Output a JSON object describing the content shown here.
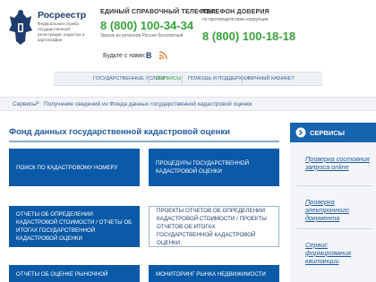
{
  "header": {
    "brand_name": "Росреестр",
    "brand_subtitle": "Федеральная служба государственной регистрации, кадастра и картографии",
    "hotline_title": "ЕДИНЫЙ СПРАВОЧНЫЙ ТЕЛЕФОН:",
    "hotline_phone": "8 (800) 100-34-34",
    "hotline_note": "Звонок из регионов России бесплатный",
    "trust_title": "ТЕЛЕФОН ДОВЕРИЯ",
    "trust_note": "по противодействию коррупции",
    "trust_phone": "8 (800) 100-18-18",
    "social_label": "Будьте с нами:",
    "social_vk": "B"
  },
  "nav": {
    "items": [
      {
        "label": "ГОСУДАРСТВЕННЫЕ УСЛУГИ",
        "active": false
      },
      {
        "label": "СЕРВИСЫ",
        "active": true
      },
      {
        "label": "ПОМОЩЬ И ПОДДЕРЖКА",
        "active": false
      },
      {
        "label": "ЛИЧНЫЙ КАБИНЕТ",
        "active": false
      }
    ]
  },
  "breadcrumb": {
    "items": [
      "Сервисы",
      "Получение сведений из Фонда данных государственной кадастровой оценки"
    ],
    "separator": ">"
  },
  "main": {
    "title": "Фонд данных государственной кадастровой оценки",
    "tiles": [
      {
        "label": "ПОИСК ПО КАДАСТРОВОМУ НОМЕРУ",
        "style": "blue"
      },
      {
        "label": "ПРОЦЕДУРЫ ГОСУДАРСТВЕННОЙ КАДАСТРОВОЙ ОЦЕНКИ",
        "style": "blue"
      },
      {
        "label": "ОТЧЕТЫ ОБ ОПРЕДЕЛЕНИИ КАДАСТРОВОЙ СТОИМОСТИ / ОТЧЕТЫ ОБ ИТОГАХ ГОСУДАРСТВЕННОЙ КАДАСТРОВОЙ ОЦЕНКИ",
        "style": "blue"
      },
      {
        "label": "ПРОЕКТЫ ОТЧЕТОВ ОБ ОПРЕДЕЛЕНИИ КАДАСТРОВОЙ СТОИМОСТИ / ПРОЕКТЫ ОТЧЕТОВ ОБ ИТОГАХ ГОСУДАРСТВЕННОЙ КАДАСТРОВОЙ ОЦЕНКИ",
        "style": "white"
      },
      {
        "label": "ОТЧЕТЫ ОБ ОЦЕНКЕ РЫНОЧНОЙ",
        "style": "blue"
      },
      {
        "label": "МОНИТОРИНГ РЫНКА НЕДВИЖИМОСТИ",
        "style": "blue"
      }
    ]
  },
  "sidebar": {
    "title": "СЕРВИСЫ",
    "links": [
      "Проверка состояния запроса online",
      "Проверка электронного документа",
      "Сервис формирования квитанции"
    ]
  },
  "colors": {
    "brand_blue": "#0b5aa8",
    "phone_green": "#38a33a",
    "link_blue": "#1f5a9e"
  }
}
